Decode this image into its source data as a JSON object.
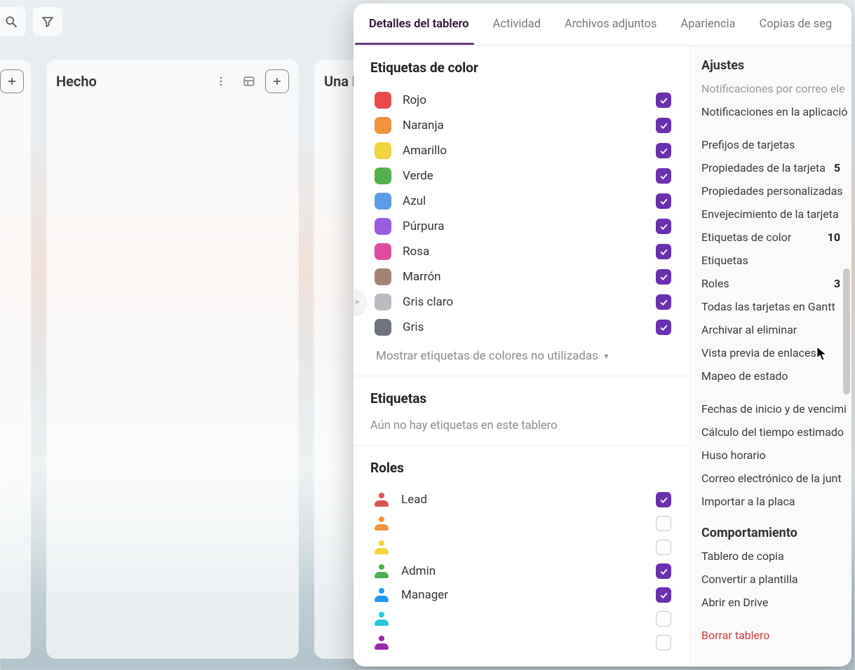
{
  "toolbar": {
    "search_icon": "search",
    "filter_icon": "filter"
  },
  "lists": [
    {
      "title": "Hecho"
    },
    {
      "title": "Una lista"
    }
  ],
  "panel": {
    "tabs": [
      {
        "label": "Detalles del tablero",
        "active": true
      },
      {
        "label": "Actividad"
      },
      {
        "label": "Archivos adjuntos"
      },
      {
        "label": "Apariencia"
      },
      {
        "label": "Copias de seg"
      }
    ],
    "sections": {
      "colorLabels": {
        "heading": "Etiquetas de color",
        "items": [
          {
            "name": "Rojo",
            "color": "#e94b4b",
            "checked": true
          },
          {
            "name": "Naranja",
            "color": "#f2923c",
            "checked": true
          },
          {
            "name": "Amarillo",
            "color": "#f4d33f",
            "checked": true
          },
          {
            "name": "Verde",
            "color": "#54b24b",
            "checked": true
          },
          {
            "name": "Azul",
            "color": "#5a9de8",
            "checked": true
          },
          {
            "name": "Púrpura",
            "color": "#9b5de0",
            "checked": true
          },
          {
            "name": "Rosa",
            "color": "#e04da0",
            "checked": true
          },
          {
            "name": "Marrón",
            "color": "#a38372",
            "checked": true
          },
          {
            "name": "Gris claro",
            "color": "#b9bdc2",
            "checked": true
          },
          {
            "name": "Gris",
            "color": "#6f747b",
            "checked": true
          }
        ],
        "showUnused": "Mostrar etiquetas de colores no utilizadas"
      },
      "labels": {
        "heading": "Etiquetas",
        "empty": "Aún no hay etiquetas en este tablero"
      },
      "roles": {
        "heading": "Roles",
        "items": [
          {
            "name": "Lead",
            "color": "#d9534f",
            "checked": true
          },
          {
            "name": "",
            "color": "#f2923c",
            "checked": false
          },
          {
            "name": "",
            "color": "#f4d33f",
            "checked": false
          },
          {
            "name": "Admin",
            "color": "#4caf50",
            "checked": true
          },
          {
            "name": "Manager",
            "color": "#2196f3",
            "checked": true
          },
          {
            "name": "",
            "color": "#26c6da",
            "checked": false
          },
          {
            "name": "",
            "color": "#9c27b0",
            "checked": false
          }
        ]
      }
    },
    "sidebar": {
      "groups": [
        {
          "heading": "Ajustes",
          "items": [
            {
              "label": "Notificaciones por correo ele",
              "faded": true
            },
            {
              "label": "Notificaciones en la aplicació"
            }
          ]
        },
        {
          "items": [
            {
              "label": "Prefijos de tarjetas"
            },
            {
              "label": "Propiedades de la tarjeta",
              "count": "5"
            },
            {
              "label": "Propiedades personalizadas"
            },
            {
              "label": "Envejecimiento de la tarjeta"
            },
            {
              "label": "Etiquetas de color",
              "count": "10"
            },
            {
              "label": "Etiquetas"
            },
            {
              "label": "Roles",
              "count": "3"
            },
            {
              "label": "Todas las tarjetas en Gantt"
            },
            {
              "label": "Archivar al eliminar"
            },
            {
              "label": "Vista previa de enlaces"
            },
            {
              "label": "Mapeo de estado"
            }
          ]
        },
        {
          "items": [
            {
              "label": "Fechas de inicio y de vencimi"
            },
            {
              "label": "Cálculo del tiempo estimado"
            },
            {
              "label": "Huso horario"
            },
            {
              "label": "Correo electrónico de la junt"
            },
            {
              "label": "Importar a la placa"
            }
          ]
        },
        {
          "heading": "Comportamiento",
          "items": [
            {
              "label": "Tablero de copia"
            },
            {
              "label": "Convertir a plantilla"
            },
            {
              "label": "Abrir en Drive"
            }
          ]
        },
        {
          "items": [
            {
              "label": "Borrar tablero",
              "danger": true
            }
          ]
        }
      ]
    }
  }
}
